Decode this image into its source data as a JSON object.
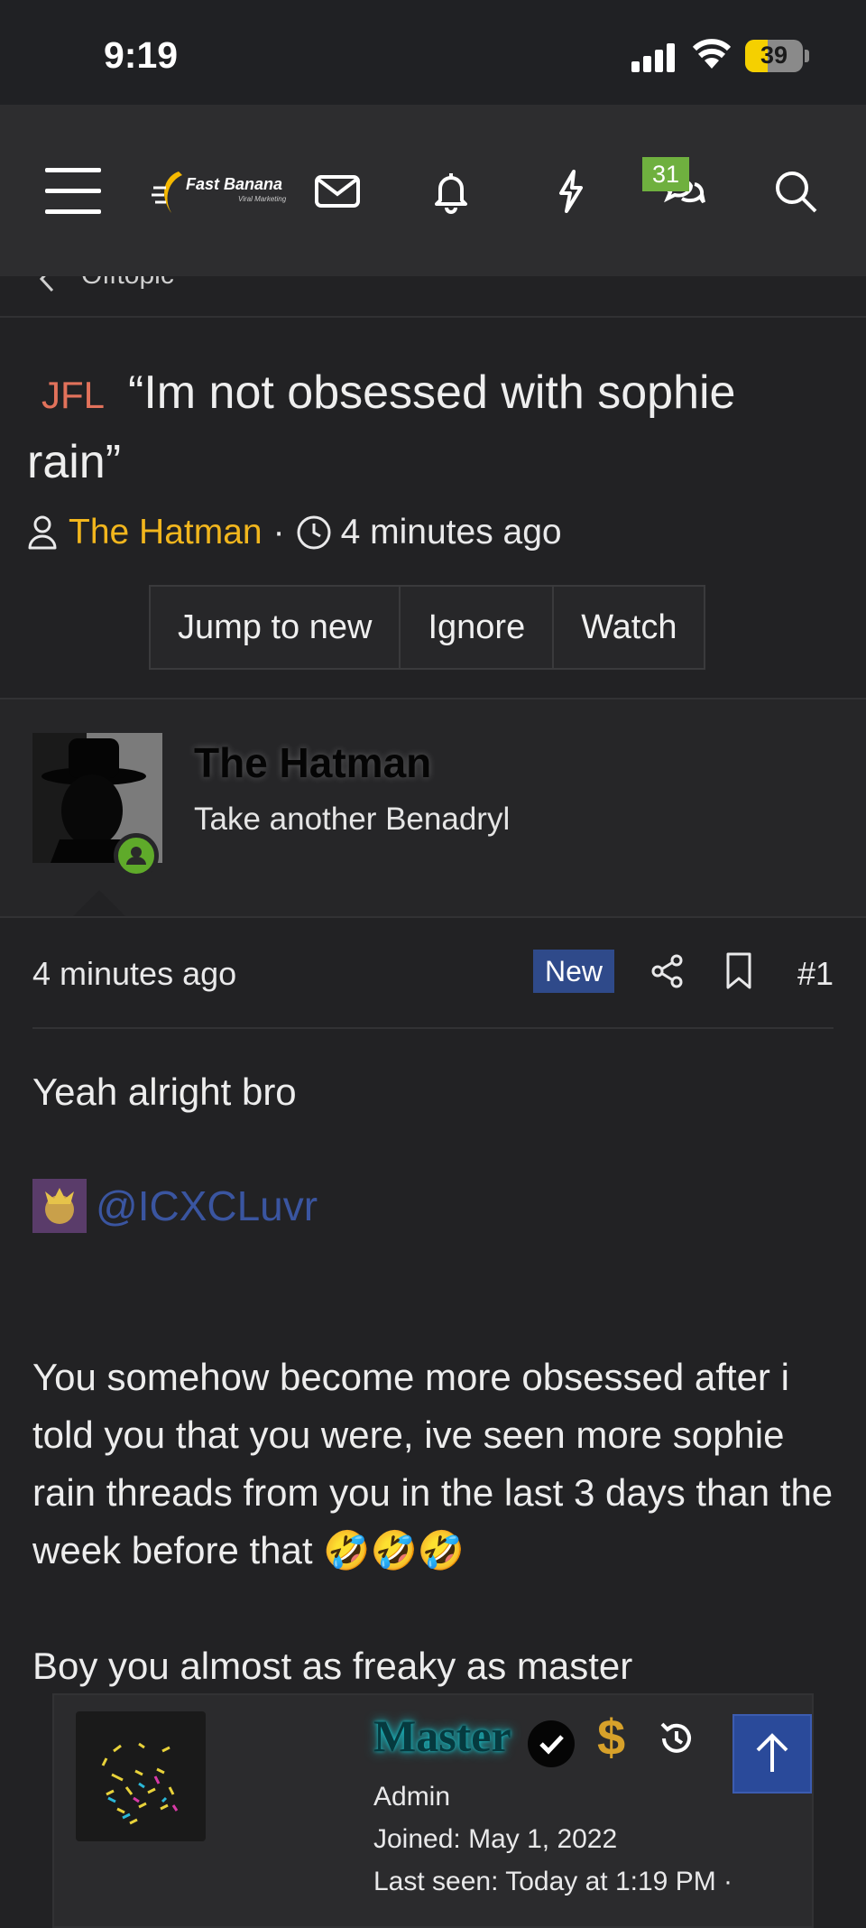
{
  "status_bar": {
    "time": "9:19",
    "battery": "39"
  },
  "header": {
    "logo_text": "Fast Banana",
    "logo_subtext": "Viral Marketing",
    "conversations_badge": "31"
  },
  "breadcrumb": {
    "label": "Offtopic"
  },
  "thread": {
    "prefix": "JFL",
    "title": "“Im not obsessed with sophie rain”",
    "author": "The Hatman",
    "separator": "·",
    "time": "4 minutes ago",
    "buttons": [
      "Jump to new",
      "Ignore",
      "Watch"
    ]
  },
  "post": {
    "user_name": "The Hatman",
    "user_title": "Take another Benadryl",
    "time": "4 minutes ago",
    "new_badge": "New",
    "number": "#1",
    "line1": "Yeah alright bro",
    "mention": "@ICXCLuvr",
    "paragraph": "You somehow become more obsessed after i told you that you were, ive seen more sophie rain threads from you in the last 3 days than the week before that 🤣🤣🤣",
    "line3": "Boy you almost as freaky as master"
  },
  "popup": {
    "name": "Master",
    "dollar": "$",
    "role": "Admin",
    "joined": "Joined: May 1, 2022",
    "last_seen": "Last seen: Today at 1:19 PM ·"
  },
  "colors": {
    "background": "#222224",
    "nav": "#2d2d2f",
    "prefix": "#e2725b",
    "author": "#f2b61d",
    "badge_green": "#6fb03f",
    "new_badge": "#2f4a8a",
    "mention": "#3a55a0"
  }
}
